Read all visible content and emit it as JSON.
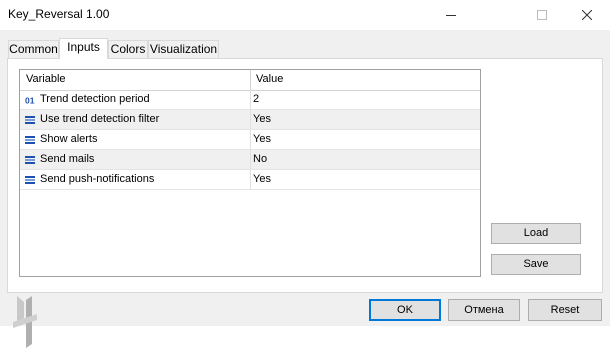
{
  "window": {
    "title": "Key_Reversal 1.00"
  },
  "tabs": [
    {
      "label": "Common"
    },
    {
      "label": "Inputs"
    },
    {
      "label": "Colors"
    },
    {
      "label": "Visualization"
    }
  ],
  "active_tab": "Inputs",
  "grid": {
    "headers": {
      "variable": "Variable",
      "value": "Value"
    },
    "rows": [
      {
        "icon": "integer-param-icon",
        "name": "Trend detection period",
        "value": "2"
      },
      {
        "icon": "bool-param-icon",
        "name": "Use trend detection filter",
        "value": "Yes"
      },
      {
        "icon": "bool-param-icon",
        "name": "Show alerts",
        "value": "Yes"
      },
      {
        "icon": "bool-param-icon",
        "name": "Send mails",
        "value": "No"
      },
      {
        "icon": "bool-param-icon",
        "name": "Send push-notifications",
        "value": "Yes"
      }
    ]
  },
  "buttons": {
    "load": "Load",
    "save": "Save",
    "ok": "OK",
    "cancel": "Отмена",
    "reset": "Reset"
  },
  "colors": {
    "focus_border": "#0078d7",
    "row_shade": "#f0f0f0",
    "int_icon": "#1e50b4",
    "bool_icon": "#1e50b4"
  }
}
